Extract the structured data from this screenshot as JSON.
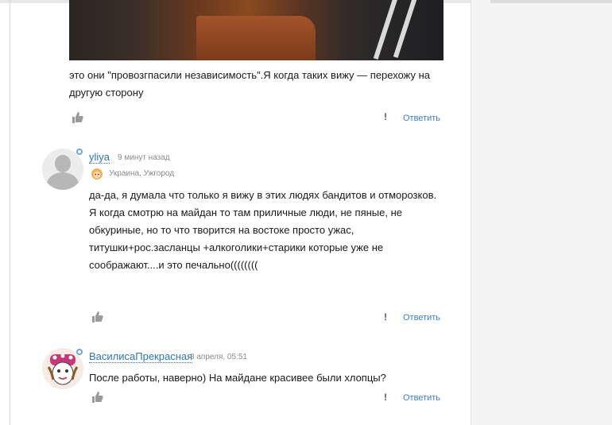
{
  "post": {
    "text": "это они \"провозгпасили независимость\".Я когда таких вижу — перехожу на другую сторону",
    "report_icon": "exclamation-icon",
    "reply_label": "Ответить",
    "like_icon": "thumbs-up-icon"
  },
  "comments": [
    {
      "author": "yliya",
      "time": "9 минут назад",
      "location": "Украина, Ужгород",
      "text": "да-да, я думала что только я вижу в этих людях бандитов и отморозков. Я когда смотрю на майдан то там приличные люди, не пяные, не обкуриные, но то что творится на востоке просто ужас, титушки+рос.засланцы +алкоголики+старики которые уже не соображают....и это печально((((((((",
      "reply_label": "Ответить"
    },
    {
      "author": "ВасилисаПрекрасная",
      "time": "8 апреля, 05:51",
      "text": "После работы, наверно) На майдане красивее были хлопцы?",
      "reply_label": "Ответить"
    }
  ],
  "colors": {
    "link": "#2f74b5",
    "reply": "#3b7dc4",
    "meta": "#8a8a8a",
    "sidebar": "#f4f4f4"
  }
}
